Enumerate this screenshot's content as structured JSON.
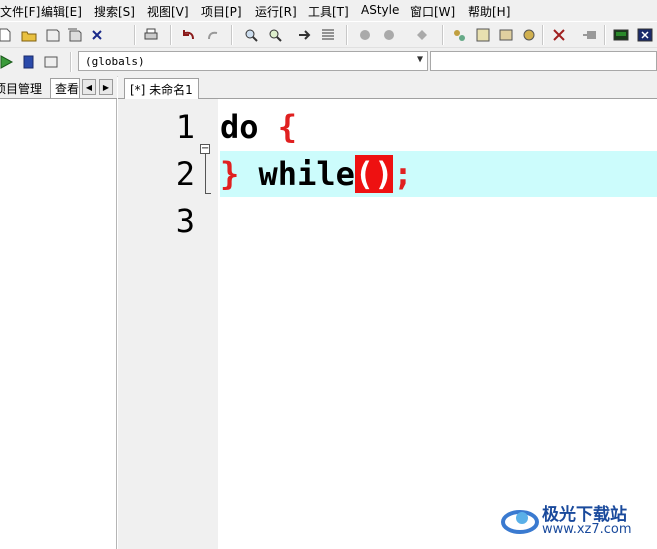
{
  "menu": {
    "file": "文件[F]",
    "edit": "编辑[E]",
    "search": "搜索[S]",
    "view": "视图[V]",
    "project": "项目[P]",
    "run": "运行[R]",
    "tools": "工具[T]",
    "astyle": "AStyle",
    "window": "窗口[W]",
    "help": "帮助[H]"
  },
  "toolbar": {
    "globals_combo": "(globals)"
  },
  "left_panel": {
    "tab_project": "项目管理",
    "tab_view": "查看"
  },
  "editor": {
    "tab_label": "[*] 未命名1",
    "line_numbers": [
      "1",
      "2",
      "3"
    ],
    "line1_kw": "do ",
    "line1_brace": "{",
    "line2_brace": "}",
    "line2_kw": " while",
    "line2_parens": "()",
    "line2_semicolon": ";",
    "highlight_color": "#ccfcfc",
    "brace_color": "#e02020",
    "match_color": "#ee1111"
  },
  "watermark": {
    "name": "极光下载站",
    "url": "www.xz7.com"
  }
}
